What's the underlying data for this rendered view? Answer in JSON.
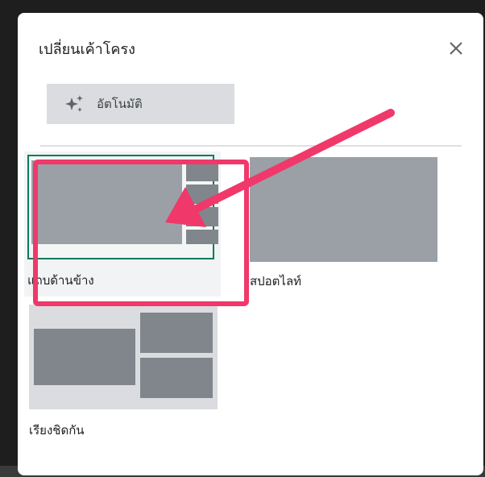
{
  "dialog": {
    "title": "เปลี่ยนเค้าโครง",
    "close_icon": "close-icon"
  },
  "auto_button": {
    "label": "อัตโนมัติ",
    "icon": "sparkle-icon"
  },
  "layouts": [
    {
      "id": "sidebar",
      "label": "แถบด้านข้าง",
      "selected": true
    },
    {
      "id": "spotlight",
      "label": "สปอตไลท์",
      "selected": false
    },
    {
      "id": "tiled",
      "label": "เรียงชิดกัน",
      "selected": false
    }
  ],
  "colors": {
    "accent_selected_border": "#0b7a5a",
    "annotation_highlight": "#f0386b",
    "tile_gray": "#9aa0a6",
    "tile_dark_gray": "#80868b"
  }
}
